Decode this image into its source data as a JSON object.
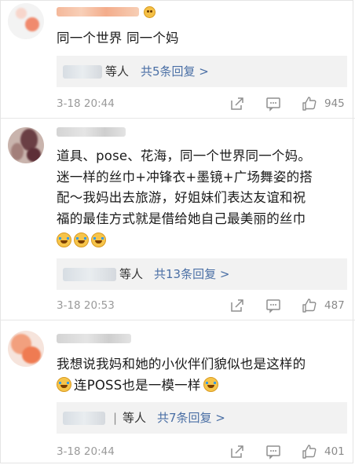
{
  "comments": [
    {
      "content": "同一个世界 同一个妈",
      "replies": {
        "sep": "",
        "suffix": "等人",
        "link": "共5条回复 >"
      },
      "meta": {
        "time": "3-18 20:44",
        "likes": "945"
      }
    },
    {
      "lines": [
        "道具、pose、花海，同一个世界同一个妈。",
        "迷一样的丝巾+冲锋衣+墨镜+广场舞姿的搭",
        "配～我妈出去旅游，好姐妹们表达友谊和祝",
        "福的最佳方式就是借给她自己最美丽的丝巾"
      ],
      "replies": {
        "sep": "",
        "suffix": "等人",
        "link": "共13条回复 >"
      },
      "meta": {
        "time": "3-18 20:53",
        "likes": "487"
      }
    },
    {
      "line1": "我想说我妈和她的小伙伴们貌似也是这样的",
      "line2": "连POSS也是一模一样",
      "replies": {
        "sep": "|",
        "suffix": "等人",
        "link": "共7条回复 >"
      },
      "meta": {
        "time": "3-18 20:44",
        "likes": "401"
      }
    }
  ],
  "icons": [
    "share-icon",
    "comment-icon",
    "like-icon",
    "laugh-cry-emoji"
  ],
  "colors": {
    "link": "#4a6fa5",
    "meta": "#9a9a9a",
    "reply_bg": "#f2f2f2"
  }
}
